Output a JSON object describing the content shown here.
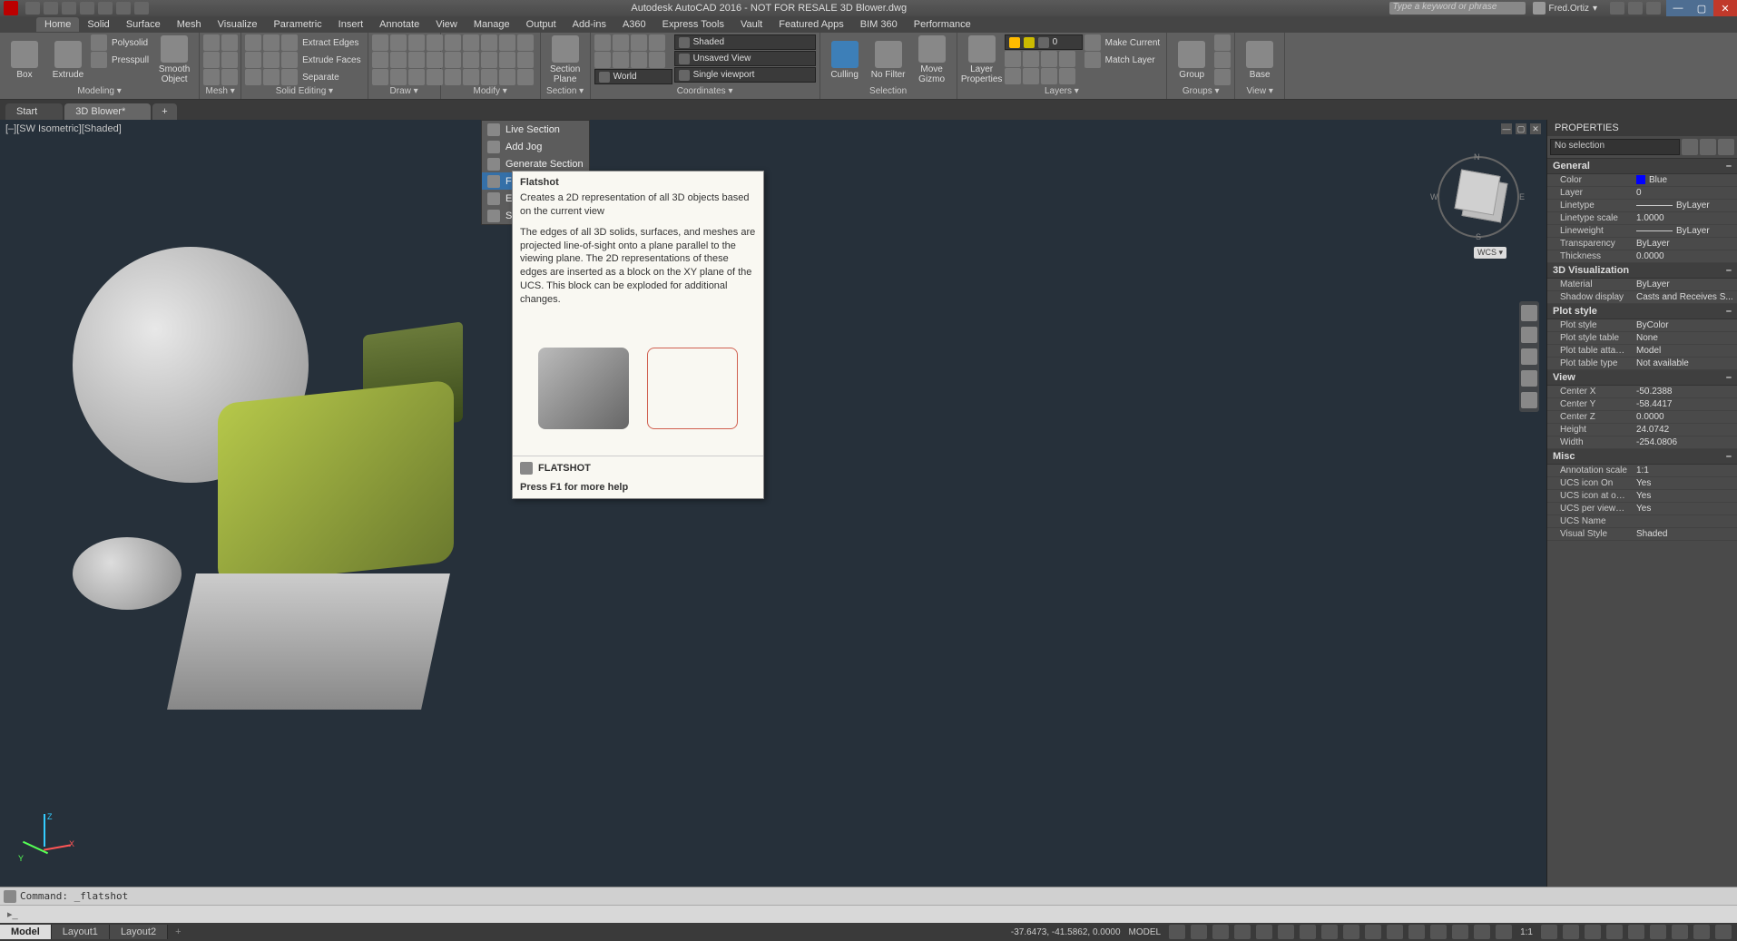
{
  "title": "Autodesk AutoCAD 2016 - NOT FOR RESALE   3D Blower.dwg",
  "search_placeholder": "Type a keyword or phrase",
  "user": "Fred.Ortiz",
  "menus": [
    "Home",
    "Solid",
    "Surface",
    "Mesh",
    "Visualize",
    "Parametric",
    "Insert",
    "Annotate",
    "View",
    "Manage",
    "Output",
    "Add-ins",
    "A360",
    "Express Tools",
    "Vault",
    "Featured Apps",
    "BIM 360",
    "Performance"
  ],
  "active_menu": "Home",
  "ribbon": {
    "modeling": {
      "title": "Modeling ▾",
      "box": "Box",
      "extrude": "Extrude",
      "polysolid": "Polysolid",
      "presspull": "Presspull",
      "smooth": "Smooth Object"
    },
    "mesh": {
      "title": "Mesh ▾"
    },
    "solidedit": {
      "title": "Solid Editing ▾",
      "extract_edges": "Extract Edges",
      "extrude_faces": "Extrude Faces",
      "separate": "Separate"
    },
    "draw": {
      "title": "Draw ▾"
    },
    "modify": {
      "title": "Modify ▾"
    },
    "section": {
      "title": "Section ▾",
      "plane": "Section Plane"
    },
    "coordinates": {
      "title": "Coordinates ▾",
      "world": "World",
      "shaded": "Shaded",
      "unsaved": "Unsaved View",
      "viewport": "Single viewport"
    },
    "selection": {
      "title": "Selection",
      "culling": "Culling",
      "nofilter": "No Filter",
      "gizmo": "Move Gizmo"
    },
    "layers": {
      "title": "Layers ▾",
      "props": "Layer Properties",
      "zero": "0",
      "make_current": "Make Current",
      "match": "Match Layer"
    },
    "groups": {
      "title": "Groups ▾",
      "group": "Group"
    },
    "view": {
      "title": "View ▾",
      "base": "Base"
    }
  },
  "filetabs": {
    "start": "Start",
    "blower": "3D Blower*"
  },
  "viewport_label": "[–][SW Isometric][Shaded]",
  "wcs": "WCS ▾",
  "section_menu": [
    "Live Section",
    "Add Jog",
    "Generate Section",
    "Flatshot",
    "Extract",
    "Section"
  ],
  "section_menu_hover": "Flatshot",
  "tooltip": {
    "title": "Flatshot",
    "p1": "Creates a 2D representation of all 3D objects based on the current view",
    "p2": "The edges of all 3D solids, surfaces, and meshes are projected line-of-sight onto a plane parallel to the viewing plane. The 2D representations of these edges are inserted as a block on the XY plane of the UCS. This block can be exploded for additional changes.",
    "cmd": "FLATSHOT",
    "help": "Press F1 for more help"
  },
  "properties": {
    "title": "PROPERTIES",
    "selection": "No selection",
    "sections": [
      {
        "name": "General",
        "rows": [
          {
            "k": "Color",
            "v": "Blue",
            "swatch": true
          },
          {
            "k": "Layer",
            "v": "0"
          },
          {
            "k": "Linetype",
            "v": "ByLayer",
            "line": true
          },
          {
            "k": "Linetype scale",
            "v": "1.0000"
          },
          {
            "k": "Lineweight",
            "v": "ByLayer",
            "line": true
          },
          {
            "k": "Transparency",
            "v": "ByLayer"
          },
          {
            "k": "Thickness",
            "v": "0.0000"
          }
        ]
      },
      {
        "name": "3D Visualization",
        "rows": [
          {
            "k": "Material",
            "v": "ByLayer"
          },
          {
            "k": "Shadow display",
            "v": "Casts and Receives S..."
          }
        ]
      },
      {
        "name": "Plot style",
        "rows": [
          {
            "k": "Plot style",
            "v": "ByColor"
          },
          {
            "k": "Plot style table",
            "v": "None"
          },
          {
            "k": "Plot table attac...",
            "v": "Model"
          },
          {
            "k": "Plot table type",
            "v": "Not available"
          }
        ]
      },
      {
        "name": "View",
        "rows": [
          {
            "k": "Center X",
            "v": "-50.2388"
          },
          {
            "k": "Center Y",
            "v": "-58.4417"
          },
          {
            "k": "Center Z",
            "v": "0.0000"
          },
          {
            "k": "Height",
            "v": "24.0742"
          },
          {
            "k": "Width",
            "v": "-254.0806"
          }
        ]
      },
      {
        "name": "Misc",
        "rows": [
          {
            "k": "Annotation scale",
            "v": "1:1"
          },
          {
            "k": "UCS icon On",
            "v": "Yes"
          },
          {
            "k": "UCS icon at ori...",
            "v": "Yes"
          },
          {
            "k": "UCS per viewport",
            "v": "Yes"
          },
          {
            "k": "UCS Name",
            "v": ""
          },
          {
            "k": "Visual Style",
            "v": "Shaded"
          }
        ]
      }
    ]
  },
  "command": "Command: _flatshot",
  "layout_tabs": [
    "Model",
    "Layout1",
    "Layout2"
  ],
  "statusbar": {
    "coords": "-37.6473, -41.5862, 0.0000",
    "model": "MODEL",
    "scale": "1:1"
  }
}
